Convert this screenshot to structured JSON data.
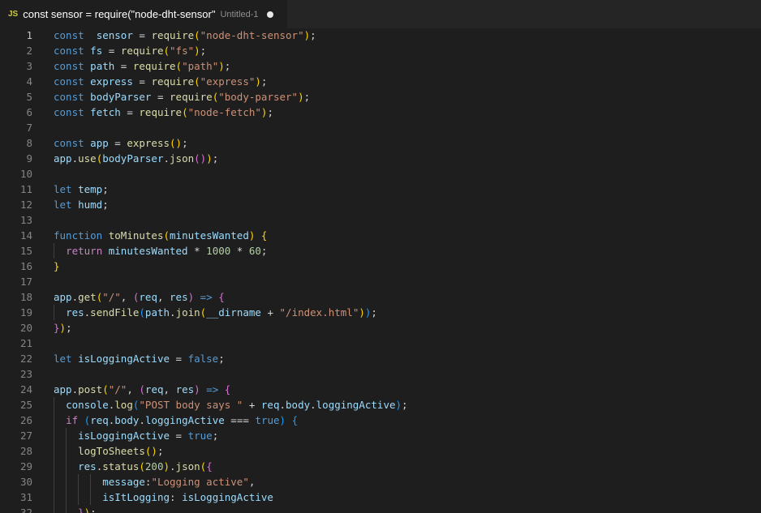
{
  "tab": {
    "lang_badge": "JS",
    "title": "const sensor = require(\"node-dht-sensor\"",
    "description": "Untitled-1",
    "modified": true
  },
  "editor": {
    "active_line": 1,
    "lines": [
      {
        "n": 1,
        "t": [
          [
            "kw",
            "const"
          ],
          [
            "",
            "  "
          ],
          [
            "var",
            "sensor"
          ],
          [
            "",
            " = "
          ],
          [
            "fn",
            "require"
          ],
          [
            "b1",
            "("
          ],
          [
            "str",
            "\"node-dht-sensor\""
          ],
          [
            "b1",
            ")"
          ],
          [
            "",
            ";"
          ]
        ]
      },
      {
        "n": 2,
        "t": [
          [
            "kw",
            "const"
          ],
          [
            "",
            " "
          ],
          [
            "var",
            "fs"
          ],
          [
            "",
            " = "
          ],
          [
            "fn",
            "require"
          ],
          [
            "b1",
            "("
          ],
          [
            "str",
            "\"fs\""
          ],
          [
            "b1",
            ")"
          ],
          [
            "",
            ";"
          ]
        ]
      },
      {
        "n": 3,
        "t": [
          [
            "kw",
            "const"
          ],
          [
            "",
            " "
          ],
          [
            "var",
            "path"
          ],
          [
            "",
            " = "
          ],
          [
            "fn",
            "require"
          ],
          [
            "b1",
            "("
          ],
          [
            "str",
            "\"path\""
          ],
          [
            "b1",
            ")"
          ],
          [
            "",
            ";"
          ]
        ]
      },
      {
        "n": 4,
        "t": [
          [
            "kw",
            "const"
          ],
          [
            "",
            " "
          ],
          [
            "var",
            "express"
          ],
          [
            "",
            " = "
          ],
          [
            "fn",
            "require"
          ],
          [
            "b1",
            "("
          ],
          [
            "str",
            "\"express\""
          ],
          [
            "b1",
            ")"
          ],
          [
            "",
            ";"
          ]
        ]
      },
      {
        "n": 5,
        "t": [
          [
            "kw",
            "const"
          ],
          [
            "",
            " "
          ],
          [
            "var",
            "bodyParser"
          ],
          [
            "",
            " = "
          ],
          [
            "fn",
            "require"
          ],
          [
            "b1",
            "("
          ],
          [
            "str",
            "\"body-parser\""
          ],
          [
            "b1",
            ")"
          ],
          [
            "",
            ";"
          ]
        ]
      },
      {
        "n": 6,
        "t": [
          [
            "kw",
            "const"
          ],
          [
            "",
            " "
          ],
          [
            "var",
            "fetch"
          ],
          [
            "",
            " = "
          ],
          [
            "fn",
            "require"
          ],
          [
            "b1",
            "("
          ],
          [
            "str",
            "\"node-fetch\""
          ],
          [
            "b1",
            ")"
          ],
          [
            "",
            ";"
          ]
        ]
      },
      {
        "n": 7,
        "t": []
      },
      {
        "n": 8,
        "t": [
          [
            "kw",
            "const"
          ],
          [
            "",
            " "
          ],
          [
            "var",
            "app"
          ],
          [
            "",
            " = "
          ],
          [
            "fn",
            "express"
          ],
          [
            "b1",
            "()"
          ],
          [
            "",
            ";"
          ]
        ]
      },
      {
        "n": 9,
        "t": [
          [
            "var",
            "app"
          ],
          [
            "",
            "."
          ],
          [
            "fn",
            "use"
          ],
          [
            "b1",
            "("
          ],
          [
            "var",
            "bodyParser"
          ],
          [
            "",
            "."
          ],
          [
            "fn",
            "json"
          ],
          [
            "b2",
            "()"
          ],
          [
            "b1",
            ")"
          ],
          [
            "",
            ";"
          ]
        ]
      },
      {
        "n": 10,
        "t": []
      },
      {
        "n": 11,
        "t": [
          [
            "kw",
            "let"
          ],
          [
            "",
            " "
          ],
          [
            "var",
            "temp"
          ],
          [
            "",
            ";"
          ]
        ]
      },
      {
        "n": 12,
        "t": [
          [
            "kw",
            "let"
          ],
          [
            "",
            " "
          ],
          [
            "var",
            "humd"
          ],
          [
            "",
            ";"
          ]
        ]
      },
      {
        "n": 13,
        "t": []
      },
      {
        "n": 14,
        "t": [
          [
            "kw",
            "function"
          ],
          [
            "",
            " "
          ],
          [
            "fn",
            "toMinutes"
          ],
          [
            "b1",
            "("
          ],
          [
            "var",
            "minutesWanted"
          ],
          [
            "b1",
            ")"
          ],
          [
            "",
            " "
          ],
          [
            "b1",
            "{"
          ]
        ]
      },
      {
        "n": 15,
        "t": [
          [
            "",
            "  "
          ],
          [
            "ctl",
            "return"
          ],
          [
            "",
            " "
          ],
          [
            "var",
            "minutesWanted"
          ],
          [
            "",
            " * "
          ],
          [
            "num",
            "1000"
          ],
          [
            "",
            " * "
          ],
          [
            "num",
            "60"
          ],
          [
            "",
            ";"
          ]
        ]
      },
      {
        "n": 16,
        "t": [
          [
            "b1",
            "}"
          ]
        ]
      },
      {
        "n": 17,
        "t": []
      },
      {
        "n": 18,
        "t": [
          [
            "var",
            "app"
          ],
          [
            "",
            "."
          ],
          [
            "fn",
            "get"
          ],
          [
            "b1",
            "("
          ],
          [
            "str",
            "\"/\""
          ],
          [
            "",
            ", "
          ],
          [
            "b2",
            "("
          ],
          [
            "var",
            "req"
          ],
          [
            "",
            ", "
          ],
          [
            "var",
            "res"
          ],
          [
            "b2",
            ")"
          ],
          [
            "",
            " "
          ],
          [
            "kw",
            "=>"
          ],
          [
            "",
            " "
          ],
          [
            "b2",
            "{"
          ]
        ]
      },
      {
        "n": 19,
        "t": [
          [
            "",
            "  "
          ],
          [
            "var",
            "res"
          ],
          [
            "",
            "."
          ],
          [
            "fn",
            "sendFile"
          ],
          [
            "b3",
            "("
          ],
          [
            "var",
            "path"
          ],
          [
            "",
            "."
          ],
          [
            "fn",
            "join"
          ],
          [
            "b1",
            "("
          ],
          [
            "var",
            "__dirname"
          ],
          [
            "",
            " + "
          ],
          [
            "str",
            "\"/index.html\""
          ],
          [
            "b1",
            ")"
          ],
          [
            "b3",
            ")"
          ],
          [
            "",
            ";"
          ]
        ]
      },
      {
        "n": 20,
        "t": [
          [
            "b2",
            "}"
          ],
          [
            "b1",
            ")"
          ],
          [
            "",
            ";"
          ]
        ]
      },
      {
        "n": 21,
        "t": []
      },
      {
        "n": 22,
        "t": [
          [
            "kw",
            "let"
          ],
          [
            "",
            " "
          ],
          [
            "var",
            "isLoggingActive"
          ],
          [
            "",
            " = "
          ],
          [
            "kw",
            "false"
          ],
          [
            "",
            ";"
          ]
        ]
      },
      {
        "n": 23,
        "t": []
      },
      {
        "n": 24,
        "t": [
          [
            "var",
            "app"
          ],
          [
            "",
            "."
          ],
          [
            "fn",
            "post"
          ],
          [
            "b1",
            "("
          ],
          [
            "str",
            "\"/\""
          ],
          [
            "",
            ", "
          ],
          [
            "b2",
            "("
          ],
          [
            "var",
            "req"
          ],
          [
            "",
            ", "
          ],
          [
            "var",
            "res"
          ],
          [
            "b2",
            ")"
          ],
          [
            "",
            " "
          ],
          [
            "kw",
            "=>"
          ],
          [
            "",
            " "
          ],
          [
            "b2",
            "{"
          ]
        ]
      },
      {
        "n": 25,
        "t": [
          [
            "",
            "  "
          ],
          [
            "var",
            "console"
          ],
          [
            "",
            "."
          ],
          [
            "fn",
            "log"
          ],
          [
            "b3",
            "("
          ],
          [
            "str",
            "\"POST body says \""
          ],
          [
            "",
            " + "
          ],
          [
            "var",
            "req"
          ],
          [
            "",
            "."
          ],
          [
            "var",
            "body"
          ],
          [
            "",
            "."
          ],
          [
            "var",
            "loggingActive"
          ],
          [
            "b3",
            ")"
          ],
          [
            "",
            ";"
          ]
        ]
      },
      {
        "n": 26,
        "t": [
          [
            "",
            "  "
          ],
          [
            "ctl",
            "if"
          ],
          [
            "",
            " "
          ],
          [
            "b3",
            "("
          ],
          [
            "var",
            "req"
          ],
          [
            "",
            "."
          ],
          [
            "var",
            "body"
          ],
          [
            "",
            "."
          ],
          [
            "var",
            "loggingActive"
          ],
          [
            "",
            " === "
          ],
          [
            "kw",
            "true"
          ],
          [
            "b3",
            ")"
          ],
          [
            "",
            " "
          ],
          [
            "b3",
            "{"
          ]
        ]
      },
      {
        "n": 27,
        "t": [
          [
            "",
            "    "
          ],
          [
            "var",
            "isLoggingActive"
          ],
          [
            "",
            " = "
          ],
          [
            "kw",
            "true"
          ],
          [
            "",
            ";"
          ]
        ]
      },
      {
        "n": 28,
        "t": [
          [
            "",
            "    "
          ],
          [
            "fn",
            "logToSheets"
          ],
          [
            "b1",
            "()"
          ],
          [
            "",
            ";"
          ]
        ]
      },
      {
        "n": 29,
        "t": [
          [
            "",
            "    "
          ],
          [
            "var",
            "res"
          ],
          [
            "",
            "."
          ],
          [
            "fn",
            "status"
          ],
          [
            "b1",
            "("
          ],
          [
            "num",
            "200"
          ],
          [
            "b1",
            ")"
          ],
          [
            "",
            "."
          ],
          [
            "fn",
            "json"
          ],
          [
            "b1",
            "("
          ],
          [
            "b2",
            "{"
          ]
        ]
      },
      {
        "n": 30,
        "t": [
          [
            "",
            "        "
          ],
          [
            "var",
            "message"
          ],
          [
            "",
            ":"
          ],
          [
            "str",
            "\"Logging active\""
          ],
          [
            "",
            ","
          ]
        ]
      },
      {
        "n": 31,
        "t": [
          [
            "",
            "        "
          ],
          [
            "var",
            "isItLogging"
          ],
          [
            "",
            ": "
          ],
          [
            "var",
            "isLoggingActive"
          ]
        ]
      },
      {
        "n": 32,
        "t": [
          [
            "",
            "    "
          ],
          [
            "b2",
            "}"
          ],
          [
            "b1",
            ")"
          ],
          [
            "",
            ";"
          ]
        ]
      }
    ]
  }
}
